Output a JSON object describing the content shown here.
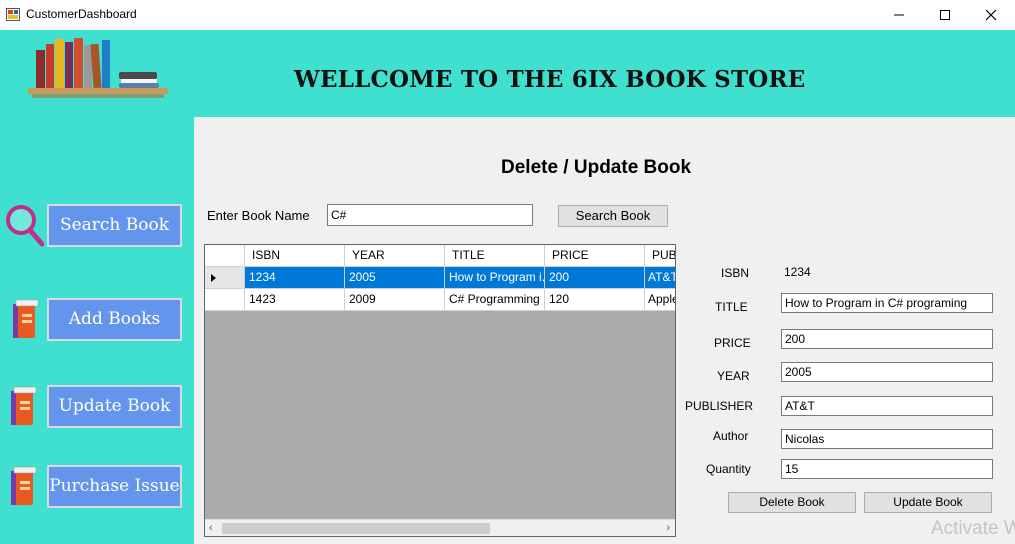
{
  "window": {
    "title": "CustomerDashboard"
  },
  "header": {
    "banner": "WELLCOME TO THE 6IX BOOK STORE"
  },
  "nav": {
    "items": [
      {
        "label": "Search Book",
        "icon": "magnifier-icon"
      },
      {
        "label": "Add Books",
        "icon": "book-icon"
      },
      {
        "label": "Update Book",
        "icon": "book-icon"
      },
      {
        "label": "Purchase Issue",
        "icon": "book-icon"
      }
    ]
  },
  "main": {
    "title": "Delete / Update Book",
    "search_label": "Enter Book Name",
    "search_value": "C#",
    "search_button": "Search Book",
    "grid": {
      "columns": [
        "ISBN",
        "YEAR",
        "TITLE",
        "PRICE",
        "PUB"
      ],
      "rows": [
        {
          "isbn": "1234",
          "year": "2005",
          "title": "How to Program i...",
          "price": "200",
          "publisher": "AT&T",
          "selected": true
        },
        {
          "isbn": "1423",
          "year": "2009",
          "title": "C# Programming",
          "price": "120",
          "publisher": "Apple",
          "selected": false
        }
      ]
    },
    "details": {
      "isbn_label": "ISBN",
      "isbn_value": "1234",
      "title_label": "TITLE",
      "title_value": "How to Program in C# programing",
      "price_label": "PRICE",
      "price_value": "200",
      "year_label": "YEAR",
      "year_value": "2005",
      "publisher_label": "PUBLISHER",
      "publisher_value": "AT&T",
      "author_label": "Author",
      "author_value": "Nicolas",
      "quantity_label": "Quantity",
      "quantity_value": "15"
    },
    "delete_button": "Delete Book",
    "update_button": "Update Book"
  },
  "watermark": "Activate W",
  "colors": {
    "background": "#40e0d0",
    "nav_button": "#6495ed",
    "selection": "#0078d7",
    "panel": "#f0f0f0"
  }
}
